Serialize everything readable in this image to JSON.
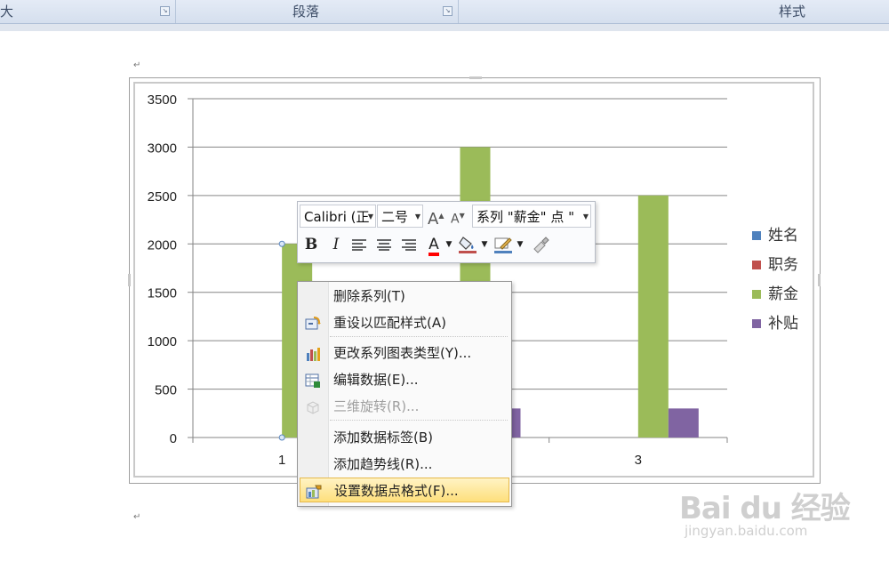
{
  "ribbon": {
    "groups": [
      "大",
      "段落",
      "样式"
    ]
  },
  "chart_data": {
    "type": "bar",
    "categories": [
      "1",
      "2",
      "3"
    ],
    "series": [
      {
        "name": "姓名",
        "color": "#4f81bd",
        "values": [
          0,
          0,
          0
        ]
      },
      {
        "name": "职务",
        "color": "#c0504d",
        "values": [
          0,
          0,
          0
        ]
      },
      {
        "name": "薪金",
        "color": "#9bbb59",
        "values": [
          2000,
          3000,
          2500
        ]
      },
      {
        "name": "补贴",
        "color": "#8064a2",
        "values": [
          0,
          300,
          300
        ]
      }
    ],
    "ylim": [
      0,
      3500
    ],
    "yticks": [
      "0",
      "500",
      "1000",
      "1500",
      "2000",
      "2500",
      "3000",
      "3500"
    ],
    "grid": true,
    "legend": "right"
  },
  "minitoolbar": {
    "font_name": "Calibri (正",
    "font_size": "二号",
    "series_selector": "系列 \"薪金\" 点 \"",
    "bold": "B",
    "italic": "I",
    "font_color": "#ff0000",
    "fill_color": "#c0504d",
    "line_color": "#4f81bd"
  },
  "context_menu": {
    "items": [
      {
        "label": "删除系列(T)",
        "icon": "none"
      },
      {
        "label": "重设以匹配样式(A)",
        "icon": "reset-style-icon"
      },
      {
        "label": "更改系列图表类型(Y)...",
        "icon": "chart-type-icon"
      },
      {
        "label": "编辑数据(E)...",
        "icon": "edit-data-icon"
      },
      {
        "label": "三维旋转(R)...",
        "icon": "rotate-3d-icon",
        "disabled": true
      },
      {
        "label": "添加数据标签(B)",
        "icon": "none"
      },
      {
        "label": "添加趋势线(R)...",
        "icon": "none"
      },
      {
        "label": "设置数据点格式(F)...",
        "icon": "format-point-icon",
        "highlighted": true
      }
    ]
  },
  "watermark": {
    "logo": "Bai du 经验",
    "url": "jingyan.baidu.com"
  }
}
